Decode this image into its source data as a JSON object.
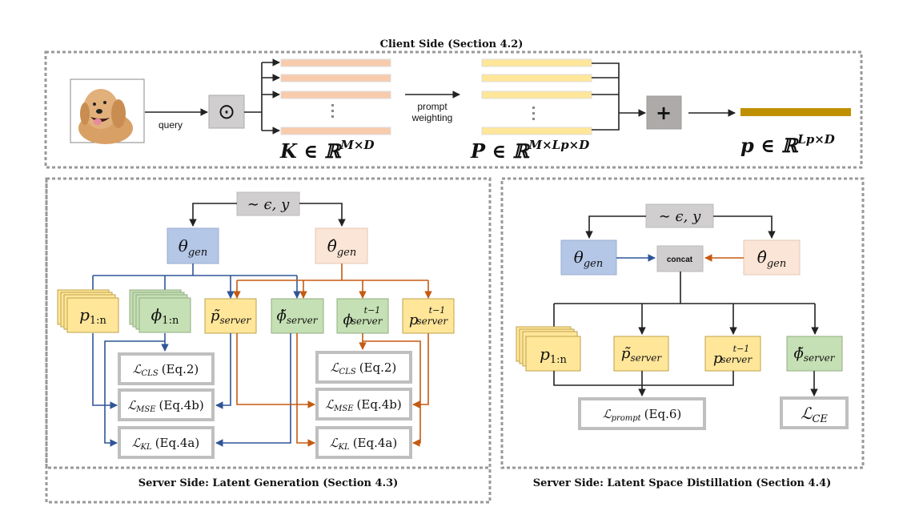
{
  "client": {
    "title": "Client Side (Section 4.2)",
    "query_label": "query",
    "hadamard_symbol": "⊙",
    "weighting_label_1": "prompt",
    "weighting_label_2": "weighting",
    "plus_symbol": "+",
    "K_label": "K ∈ ℝ",
    "K_sup": "M×D",
    "P_label": "P ∈ ℝ",
    "P_sup": "M×Lp×D",
    "p_label": "p ∈ ℝ",
    "p_sup": "Lp×D",
    "ellipsis": "⋮",
    "image_alt": "dog-photo"
  },
  "latent_generation": {
    "title": "Server Side: Latent Generation (Section 4.3)",
    "noise": "∼ ϵ,  y",
    "theta_gen": "θ",
    "theta_gen_sub": "gen",
    "theta_hat_gen": "θ̂",
    "theta_hat_gen_sub": "gen",
    "nodes": [
      {
        "main": "p",
        "sub": "1:n",
        "sup": "",
        "color": "yellow",
        "stack": true
      },
      {
        "main": "ϕ",
        "sub": "1:n",
        "sup": "",
        "color": "green",
        "stack": true
      },
      {
        "main": "p̃",
        "sub": "server",
        "sup": "",
        "color": "yellow",
        "stack": false
      },
      {
        "main": "ϕ̃",
        "sub": "server",
        "sup": "",
        "color": "green",
        "stack": false
      },
      {
        "main": "ϕ",
        "sub": "server",
        "sup": "t−1",
        "color": "green",
        "stack": false
      },
      {
        "main": "p",
        "sub": "server",
        "sup": "t−1",
        "color": "yellow",
        "stack": false
      }
    ],
    "losses_left": [
      {
        "main": "ℒ",
        "sub": "CLS",
        "eq": "(Eq.2)"
      },
      {
        "main": "ℒ",
        "sub": "MSE",
        "eq": "(Eq.4b)"
      },
      {
        "main": "ℒ",
        "sub": "KL",
        "eq": "(Eq.4a)"
      }
    ],
    "losses_right": [
      {
        "main": "ℒ",
        "sub": "CLS",
        "eq": "(Eq.2)"
      },
      {
        "main": "ℒ",
        "sub": "MSE",
        "eq": "(Eq.4b)"
      },
      {
        "main": "ℒ",
        "sub": "KL",
        "eq": "(Eq.4a)"
      }
    ]
  },
  "distillation": {
    "title": "Server Side: Latent Space Distillation (Section 4.4)",
    "noise": "∼ ϵ,  y",
    "theta_gen": "θ",
    "theta_gen_sub": "gen",
    "theta_hat_gen": "θ̂",
    "theta_hat_gen_sub": "gen",
    "concat": "concat",
    "nodes": [
      {
        "main": "p",
        "sub": "1:n",
        "sup": "",
        "color": "yellow",
        "stack": true
      },
      {
        "main": "p̃",
        "sub": "server",
        "sup": "",
        "color": "yellow",
        "stack": false
      },
      {
        "main": "p",
        "sub": "server",
        "sup": "t−1",
        "color": "yellow",
        "stack": false
      },
      {
        "main": "ϕ̃",
        "sub": "server",
        "sup": "",
        "color": "green",
        "stack": false
      }
    ],
    "loss_prompt": {
      "main": "ℒ",
      "sub": "prompt",
      "eq": "(Eq.6)"
    },
    "loss_ce": {
      "main": "ℒ",
      "sub": "CE",
      "eq": ""
    }
  },
  "colors": {
    "blue_flow": "#2f5597",
    "orange_flow": "#c55a11",
    "key_bar": "#f8cbad",
    "prompt_bar": "#ffe699",
    "final_prompt": "#bf9000"
  }
}
